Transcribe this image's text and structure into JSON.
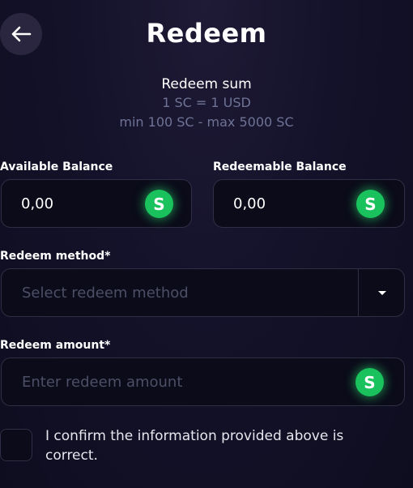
{
  "header": {
    "title": "Redeem",
    "back_icon": "arrow-left-icon"
  },
  "summary": {
    "title": "Redeem sum",
    "rate": "1 SC = 1 USD",
    "limits": "min 100 SC - max 5000 SC"
  },
  "balances": {
    "available_label": "Available Balance",
    "available_value": "0,00",
    "redeemable_label": "Redeemable Balance",
    "redeemable_value": "0,00",
    "coin_symbol": "S",
    "coin_color": "#19c25c"
  },
  "method": {
    "label": "Redeem method*",
    "placeholder": "Select redeem method",
    "dropdown_icon": "caret-down-icon"
  },
  "amount": {
    "label": "Redeem amount*",
    "placeholder": "Enter redeem amount",
    "coin_symbol": "S"
  },
  "confirm": {
    "text": "I confirm the information provided above is correct."
  }
}
